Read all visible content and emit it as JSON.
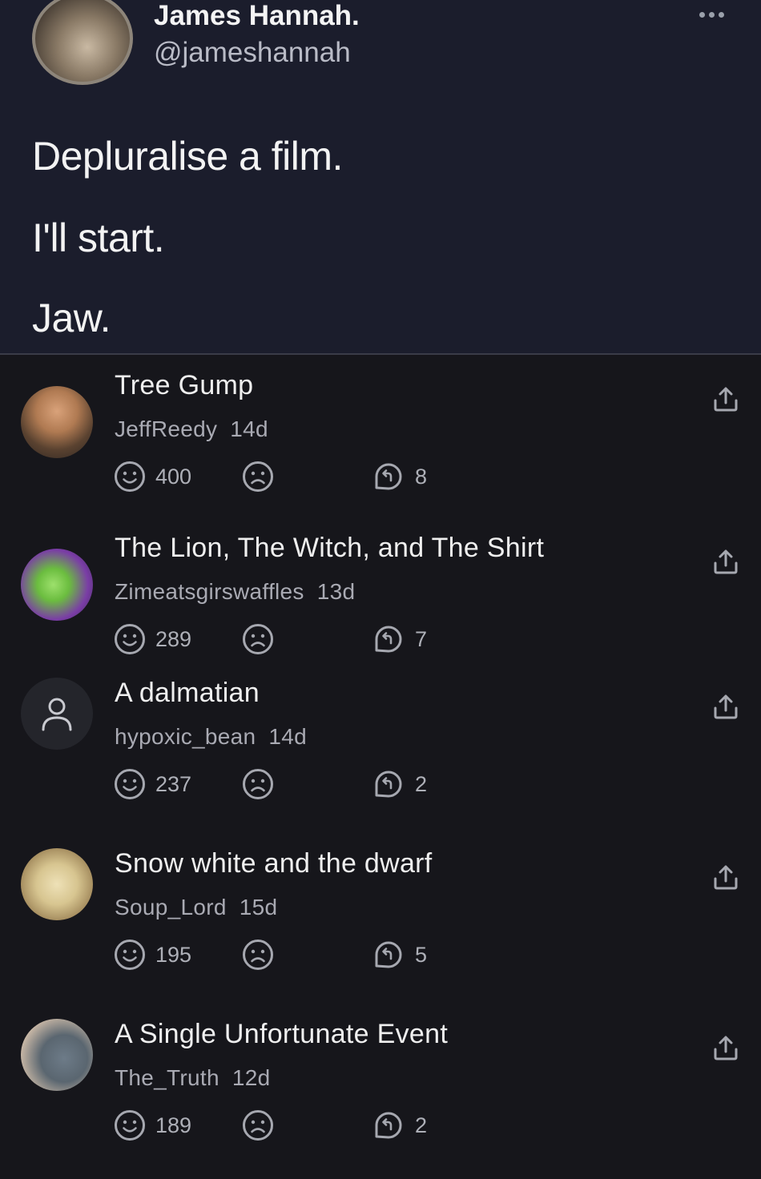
{
  "tweet": {
    "name": "James Hannah.",
    "handle": "@jameshannah",
    "lines": [
      "Depluralise a film.",
      "I'll start.",
      "Jaw."
    ]
  },
  "comments": [
    {
      "title": "Tree Gump",
      "user": "JeffReedy",
      "age": "14d",
      "upvotes": "400",
      "replies": "8"
    },
    {
      "title": "The Lion, The Witch, and The Shirt",
      "user": "Zimeatsgirswaffles",
      "age": "13d",
      "upvotes": "289",
      "replies": "7"
    },
    {
      "title": "A dalmatian",
      "user": "hypoxic_bean",
      "age": "14d",
      "upvotes": "237",
      "replies": "2"
    },
    {
      "title": "Snow white and the dwarf",
      "user": "Soup_Lord",
      "age": "15d",
      "upvotes": "195",
      "replies": "5"
    },
    {
      "title": "A Single Unfortunate Event",
      "user": "The_Truth",
      "age": "12d",
      "upvotes": "189",
      "replies": "2"
    }
  ],
  "icons": {
    "more": "more-dots-icon",
    "upvote": "smile-icon",
    "downvote": "frown-icon",
    "reply": "reply-icon",
    "share": "share-icon",
    "default_avatar": "person-icon"
  },
  "colors": {
    "tweet_bg": "#1b1d2c",
    "page_bg": "#16161b",
    "icon": "#a6a8b0"
  }
}
